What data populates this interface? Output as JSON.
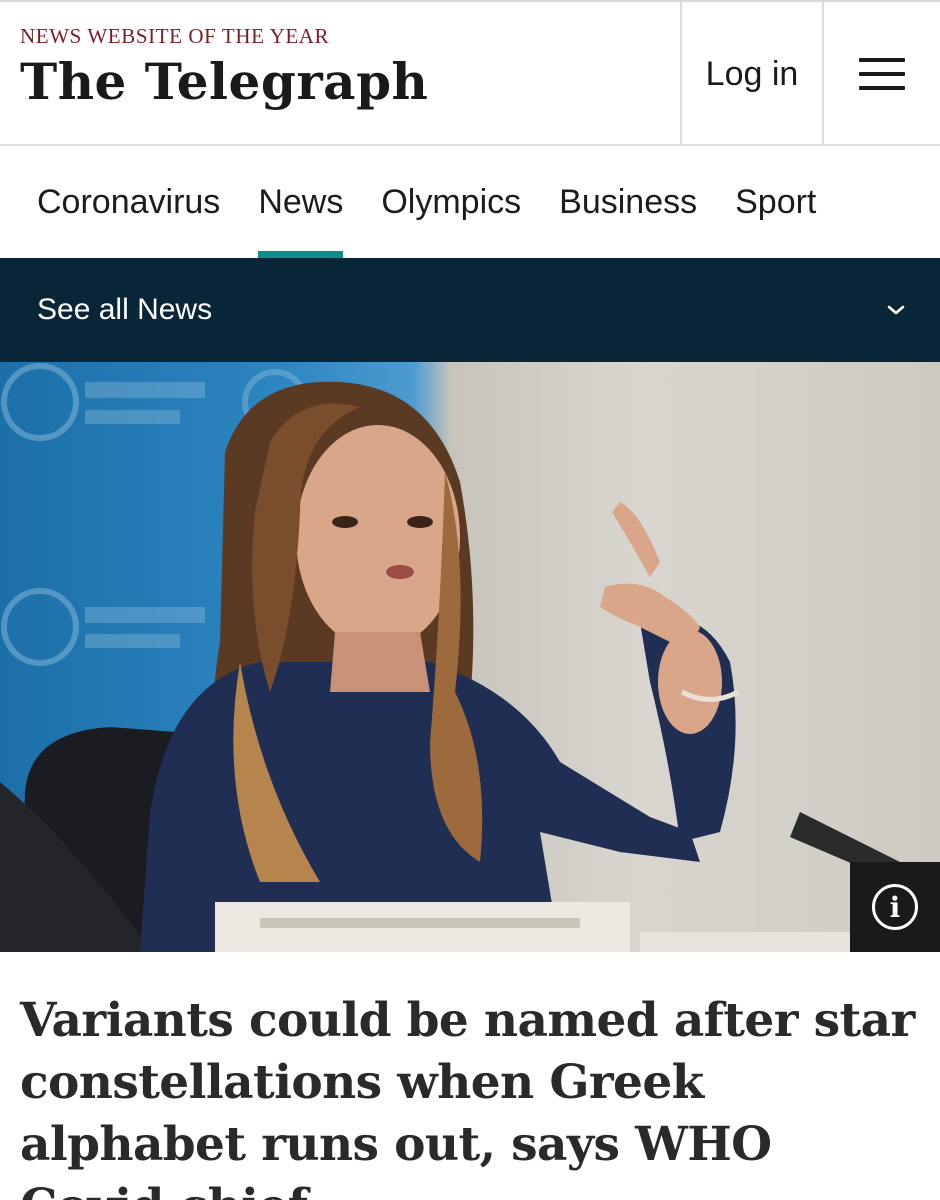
{
  "header": {
    "tagline": "NEWS WEBSITE OF THE YEAR",
    "masthead": "The Telegraph",
    "login_label": "Log in",
    "menu_icon": "hamburger-menu-icon"
  },
  "nav": {
    "items": [
      {
        "label": "Coronavirus"
      },
      {
        "label": "News",
        "active": true
      },
      {
        "label": "Olympics"
      },
      {
        "label": "Business"
      },
      {
        "label": "Sport"
      }
    ],
    "accent_color": "#0c8f87"
  },
  "section_bar": {
    "label": "See all News",
    "icon": "chevron-down-icon",
    "background": "#092538"
  },
  "hero": {
    "info_icon_glyph": "i"
  },
  "article": {
    "headline": "Variants could be named after star constellations when Greek alphabet runs out, says WHO Covid chief"
  }
}
